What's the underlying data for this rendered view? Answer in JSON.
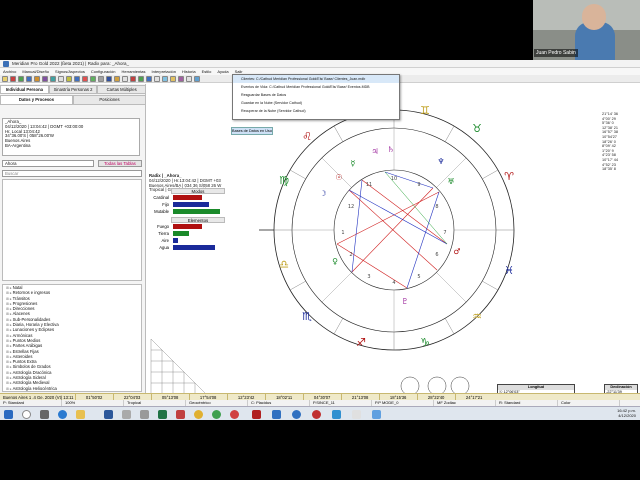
{
  "window": {
    "title": "Meridian Pro Gold 2022 (ßeta 2021) | Radix para: _Ahora_"
  },
  "menubar": {
    "items": [
      "Archivo",
      "Manual/Diseño",
      "Signos/Aspectos",
      "Configuración",
      "Herramientas",
      "Interpretación",
      "Historia",
      "Estilo",
      "Ayuda",
      "Salir",
      "Bases de Datos en Uso"
    ]
  },
  "menu_dropdown": {
    "items": [
      "Clientes: C:/Cathud Meridian Professional Gold/Els/ Base/ Clientes_Juan.mdb",
      "Eventos de Vida: C:/Cathud Meridian Professional Gold/Els/ Base/ Eventos.MDB",
      "Resguardar Bases de Datos",
      "Guardar en la Nube (Servidor Cathud)",
      "Recuperar de la Nube (Servidor Cathud)"
    ]
  },
  "left_panel": {
    "tabs_top": [
      "Individual Persona",
      "Sinastría Personas 2",
      "Cartas Múltiples"
    ],
    "tabs_sub": [
      "Datos y Procesos",
      "Posiciones"
    ],
    "info_lines": [
      "_Ahora_",
      "04/12/2020 | 13:04:42 | DGMT +03:00:00",
      "Hr. Local 13:04:42",
      "34°36.00'S | 058°26.00'W",
      "Buenos Aires",
      "BA-Argentina"
    ],
    "filter_select": "Ahora",
    "filter_button": "Todas las Tablas",
    "search_placeholder": "Buscar",
    "tree_items": [
      "Natal",
      "Retornos e ingresos",
      "Tránsitos",
      "Progresiones",
      "Direcciones",
      "Alacenes",
      "Sub-Personalidades",
      "Diaria, Horaria y Electiva",
      "Lunaciones y Eclipses",
      "Armónicas",
      "Puntos Medios",
      "Partes Arábigas",
      "Estrellas Fijas",
      "Asteroides",
      "Puntos Extra",
      "Simbolos de Grados",
      "Astrología Dracónica",
      "Astrología Sideral",
      "Astrología Medieval",
      "Astrología Heliocéntrica",
      "Cartas Locales",
      "Carta Repora (Ø Aries)",
      "Astrología Ascensional",
      "Heliocalibración"
    ],
    "analysis_button": "Análisis de Eventos - Activar"
  },
  "radix_header": {
    "name": "Radix | _Ahora_",
    "line1": "04/12/2020 | Hr.13:04:42 | DGMT +03",
    "line2": "Buenos Aires/BA | 034 36 S/058 26 W",
    "line3": "Tropical | Geocéntrico | Placidus"
  },
  "elements_box": {
    "modes_title": "Modos",
    "modes": [
      {
        "label": "Cardinal",
        "value": 0.55,
        "color": "#b01010"
      },
      {
        "label": "Fijo",
        "value": 0.7,
        "color": "#1a2a9a"
      },
      {
        "label": "Mutable",
        "value": 0.9,
        "color": "#1a8a2a"
      }
    ],
    "elements_title": "Elementos",
    "elements": [
      {
        "label": "Fuego",
        "value": 0.55,
        "color": "#b01010"
      },
      {
        "label": "Tierra",
        "value": 0.3,
        "color": "#1a8a2a"
      },
      {
        "label": "Aire",
        "value": 0.1,
        "color": "#1a2a9a"
      },
      {
        "label": "Agua",
        "value": 0.8,
        "color": "#1a2a9a"
      }
    ]
  },
  "wheel_labels": {
    "signs": [
      "♈",
      "♉",
      "♊",
      "♋",
      "♌",
      "♍",
      "♎",
      "♏",
      "♐",
      "♑",
      "♒",
      "♓"
    ],
    "planets": [
      "☉",
      "☽",
      "☿",
      "♀",
      "♂",
      "♃",
      "♄",
      "♅",
      "♆",
      "♇"
    ],
    "houses": [
      "1",
      "2",
      "3",
      "4",
      "5",
      "6",
      "7",
      "8",
      "9",
      "10",
      "11",
      "12"
    ]
  },
  "coord_table": {
    "title": "Longitud",
    "rows": [
      "☉ 12°06'03\"",
      "☽ 13°13'42\"",
      "☿ 21°13'09\"",
      "♀ 20°38'10\"",
      "♂ 23°07'40\"",
      "♃ 21°53'30\"",
      "♄ 28°28'30\"",
      "♅ 06°59'22\"",
      "♆ 18°11'30\"",
      "♇ 22°21'09\"",
      "☊ 20°28'33\"",
      "☋ 20°08'06\"",
      "As 16°06'45\"",
      "Mc 17°51'06\""
    ]
  },
  "decl_table": {
    "title": "Declinación",
    "rows": [
      "-22°11'39",
      "-21°05'56",
      "-21°56'38",
      "-15°15'30",
      "+03°25'18",
      "-21°32'08",
      "-20°31'44",
      "+12°41'48",
      "-05°32'33",
      "-22°18'46",
      "+22°07'22",
      "-22°28'21",
      "+18°23'14",
      "-22°28'22"
    ]
  },
  "side_table": {
    "rows": [
      "21°14' 36",
      "4°00' 29",
      "5°36' 0",
      "12°38' 21",
      "16°57' 38",
      "10°54'27",
      "18°26' 0",
      "8°09' 42",
      "1°20' 9",
      "4°23' 58",
      "10°17' 44",
      "4°52' 23",
      "18°35' 8"
    ]
  },
  "status_bar": {
    "location": "Buenos Aires 1 .4 Ge. 2020 (Vt) 13:11",
    "cells": [
      "01°50'02",
      "22°04'03",
      "05°13'08",
      "17°54'08",
      "12°23'42",
      "18°02'11",
      "04°30'07",
      "21°13'08",
      "18°15'36",
      "28°22'40",
      "24°17'21"
    ]
  },
  "status_bar2": {
    "items": [
      "P: Standard",
      "100%",
      "Tropical",
      "Geocéntrico",
      "C: Placidus",
      "P.SINCE_11",
      "P.P MODE_0",
      "MF Zodiac",
      "R: Standard",
      "Color"
    ]
  },
  "taskbar": {
    "time": "16:42 p.m.",
    "date": "4/12/2020"
  },
  "webcam": {
    "label": "Juan Pedro Sabin"
  },
  "colors": {
    "accent": "#3b6fb6",
    "fire": "#b01010",
    "earth": "#1a8a2a",
    "water": "#1a2a9a",
    "aspect_red": "#d02020",
    "aspect_blue": "#2030c0"
  }
}
